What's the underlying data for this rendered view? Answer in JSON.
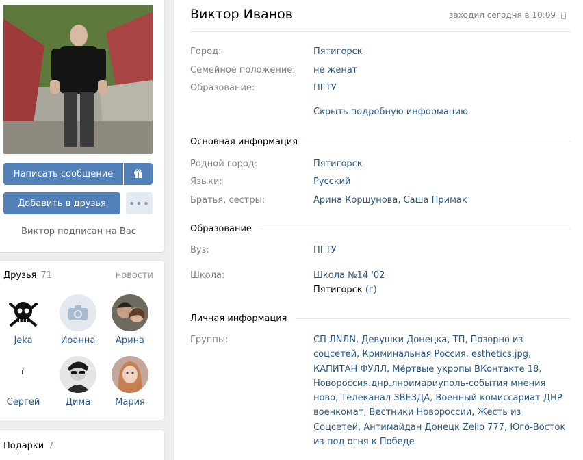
{
  "profile": {
    "name": "Виктор Иванов",
    "online_status": "заходил сегодня в 10:09",
    "write_message": "Написать сообщение",
    "add_friend": "Добавить в друзья",
    "more": "•••",
    "subscribed_note": "Виктор подписан на Вас"
  },
  "friends": {
    "title": "Друзья",
    "count": "71",
    "news": "новости",
    "items": [
      {
        "name": "Jeka"
      },
      {
        "name": "Иоанна"
      },
      {
        "name": "Арина"
      },
      {
        "name": "Сергей"
      },
      {
        "name": "Дима"
      },
      {
        "name": "Мария"
      }
    ]
  },
  "gifts": {
    "title": "Подарки",
    "count": "7"
  },
  "info": {
    "city_label": "Город:",
    "city": "Пятигорск",
    "marital_label": "Семейное положение:",
    "marital": "не женат",
    "education_label": "Образование:",
    "education": "ПГТУ",
    "toggle": "Скрыть подробную информацию",
    "main_section": "Основная информация",
    "hometown_label": "Родной город:",
    "hometown": "Пятигорск",
    "languages_label": "Языки:",
    "languages": "Русский",
    "siblings_label": "Братья, сестры:",
    "siblings": "Арина Коршунова, Саша Примак",
    "edu_section": "Образование",
    "university_label": "Вуз:",
    "university": "ПГТУ",
    "school_label": "Школа:",
    "school": "Школа №14 '02",
    "school_city": "Пятигорск",
    "school_type": "(г)",
    "personal_section": "Личная информация",
    "groups_label": "Группы:",
    "groups": "СП ЛNЛN, Девушки Донецка, ТП, Позорно из соцсетей, Криминальная Россия, esthetics.jpg, КАПИТАН ФУЛЛ, Мёртвые укропы ВКонтакте 18, Новороссия.днр.лнримариуполь-события мнения ново, Телеканал ЗВЕЗДА, Военный комиссариат ДНР военкомат, Вестники Новороссии, Жесть из Соцсетей, Антимайдан Донецк Zello 777, Юго-Восток из-под огня к Победе"
  },
  "colors": {
    "link": "#2a5885",
    "button": "#5181b8",
    "label": "#828282",
    "background": "#edeef0"
  }
}
